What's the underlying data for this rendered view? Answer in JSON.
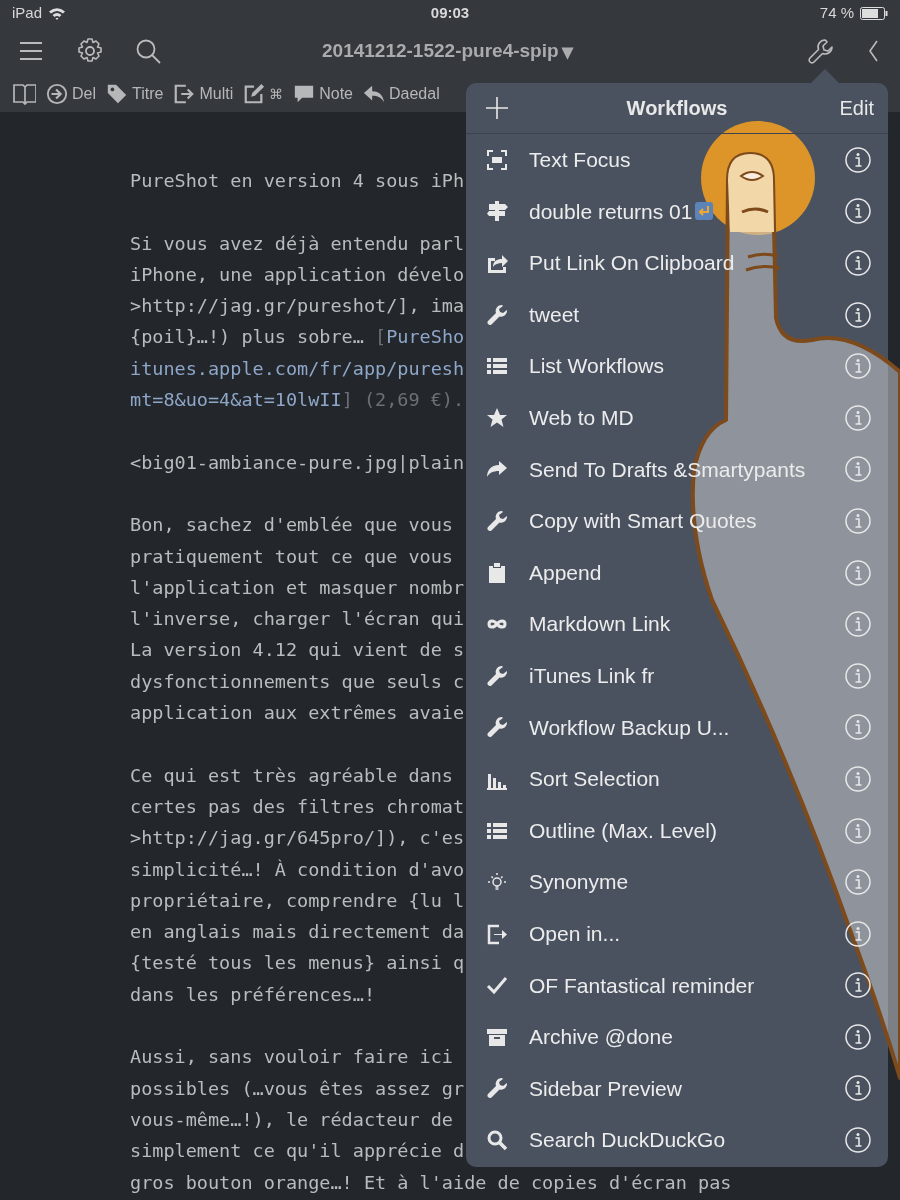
{
  "status_bar": {
    "device": "iPad",
    "time": "09:03",
    "battery": "74 %"
  },
  "nav_bar": {
    "title": "20141212-1522-pure4-spip",
    "title_caret": "▾"
  },
  "toolbar": [
    {
      "kind": "book"
    },
    {
      "kind": "arrow-circle",
      "label": "Del"
    },
    {
      "kind": "tag",
      "label": "Titre"
    },
    {
      "kind": "export",
      "label": "Multi"
    },
    {
      "kind": "edit",
      "label": "⌘"
    },
    {
      "kind": "speech",
      "label": "Note"
    },
    {
      "kind": "reply",
      "label": "Daedal"
    }
  ],
  "editor": {
    "paragraphs": [
      [
        "PureShot en version 4 sous iPh"
      ],
      [
        "Si vous avez déjà entendu parl",
        "iPhone, une application dévelo",
        ">http://jag.gr/pureshot/], ima",
        [
          {
            "text": "{poil}…!) plus sobre… ",
            "kind": "plain"
          },
          {
            "text": "[",
            "kind": "dim"
          },
          {
            "text": "PureSho",
            "kind": "link"
          }
        ],
        [
          {
            "text": "itunes.apple.com/fr/app/puresh",
            "kind": "link"
          }
        ],
        [
          {
            "text": "mt=8&uo=4&at=10lwII",
            "kind": "link"
          },
          {
            "text": "] (2,69 €).",
            "kind": "dim"
          }
        ]
      ],
      [
        "<big01-ambiance-pure.jpg|plain"
      ],
      [
        "Bon, sachez d'emblée que vous",
        "pratiquement tout ce que vous",
        "l'application et masquer nombr",
        "l'inverse, charger l'écran qui",
        "La version 4.12 qui vient de s",
        "dysfonctionnements que seuls c",
        "application aux extrêmes avaie"
      ],
      [
        "Ce qui est très agréable dans",
        "certes pas des filtres chromat",
        ">http://jag.gr/645pro/]), c'es",
        "simplicité…! À condition d'avo",
        "propriétaire, comprendre {lu l",
        "en anglais mais directement da",
        "{testé tous les menus} ainsi q",
        "dans les préférences…!"
      ],
      [
        "Aussi, sans vouloir faire ici",
        "possibles (…vous êtes assez gr",
        "vous-même…!), le rédacteur de",
        "simplement ce qu'il apprécie d",
        "gros bouton orange…! Et à l'aide de copies d'écran pas"
      ]
    ]
  },
  "workflows": {
    "title": "Workflows",
    "edit": "Edit",
    "items": [
      {
        "label": "Text Focus",
        "kind": "focus",
        "badge": false
      },
      {
        "label": "double returns 01",
        "kind": "signpost",
        "badge": true
      },
      {
        "label": "Put Link On Clipboard",
        "kind": "share",
        "badge": false
      },
      {
        "label": "tweet",
        "kind": "wrench",
        "badge": false
      },
      {
        "label": "List Workflows",
        "kind": "list",
        "badge": false
      },
      {
        "label": "Web to MD",
        "kind": "star",
        "badge": false
      },
      {
        "label": "Send To Drafts &Smartypants",
        "kind": "forward",
        "badge": false
      },
      {
        "label": "Copy with Smart Quotes",
        "kind": "wrench",
        "badge": false
      },
      {
        "label": "Append",
        "kind": "clipboard",
        "badge": false
      },
      {
        "label": "Markdown Link",
        "kind": "infinity",
        "badge": false
      },
      {
        "label": "iTunes Link fr",
        "kind": "wrench",
        "badge": false
      },
      {
        "label": "Workflow Backup U...",
        "kind": "wrench",
        "badge": false
      },
      {
        "label": "Sort Selection",
        "kind": "chart",
        "badge": false
      },
      {
        "label": "Outline (Max. Level)",
        "kind": "list",
        "badge": false
      },
      {
        "label": "Synonyme",
        "kind": "bulb",
        "badge": false
      },
      {
        "label": "Open in...",
        "kind": "exit",
        "badge": false
      },
      {
        "label": "OF Fantastical reminder",
        "kind": "check",
        "badge": false
      },
      {
        "label": "Archive @done",
        "kind": "archive",
        "badge": false
      },
      {
        "label": "Sidebar Preview",
        "kind": "wrench",
        "badge": false
      },
      {
        "label": "Search DuckDuckGo",
        "kind": "search",
        "badge": false
      }
    ]
  }
}
